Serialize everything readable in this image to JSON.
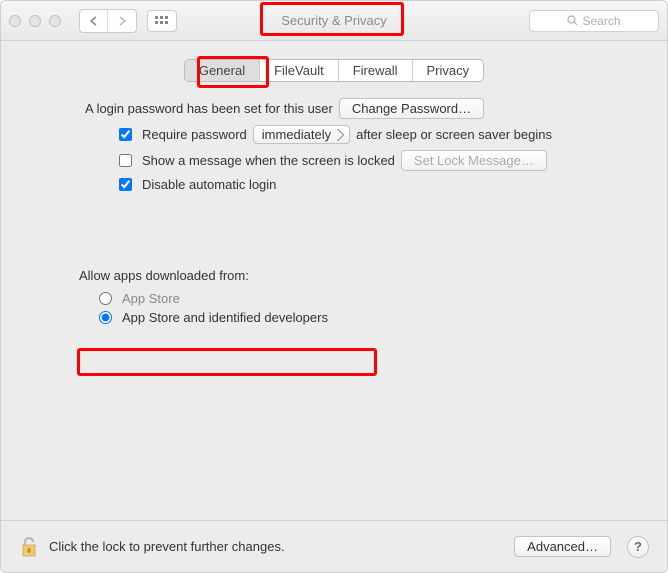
{
  "titlebar": {
    "title": "Security & Privacy",
    "search_placeholder": "Search"
  },
  "tabs": {
    "general": "General",
    "filevault": "FileVault",
    "firewall": "Firewall",
    "privacy": "Privacy"
  },
  "general": {
    "password_set_text": "A login password has been set for this user",
    "change_password_btn": "Change Password…",
    "require_password_label": "Require password",
    "require_password_delay": "immediately",
    "require_password_suffix": "after sleep or screen saver begins",
    "show_message_label": "Show a message when the screen is locked",
    "set_lock_message_btn": "Set Lock Message…",
    "disable_auto_login_label": "Disable automatic login"
  },
  "download": {
    "heading": "Allow apps downloaded from:",
    "opt_appstore": "App Store",
    "opt_identified": "App Store and identified developers"
  },
  "footer": {
    "lock_text": "Click the lock to prevent further changes.",
    "advanced_btn": "Advanced…"
  }
}
